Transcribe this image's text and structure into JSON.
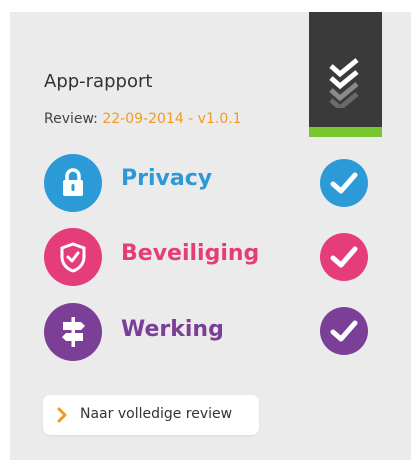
{
  "header": {
    "title": "App-rapport",
    "review_label": "Review:",
    "review_value": "22-09-2014 - v1.0.1"
  },
  "badge": {
    "icon": "double-check-icon",
    "accent_color": "#7ac631",
    "background_color": "#3a3a3a"
  },
  "categories": [
    {
      "label": "Privacy",
      "icon": "lock-icon",
      "color": "#2d9ad8",
      "status": "checked"
    },
    {
      "label": "Beveiliging",
      "icon": "shield-icon",
      "color": "#e53d7a",
      "status": "checked"
    },
    {
      "label": "Werking",
      "icon": "signpost-icon",
      "color": "#7b3f98",
      "status": "checked"
    }
  ],
  "footer": {
    "button_label": "Naar volledige review",
    "button_icon": "chevron-right-icon",
    "icon_color": "#f39a1e"
  }
}
